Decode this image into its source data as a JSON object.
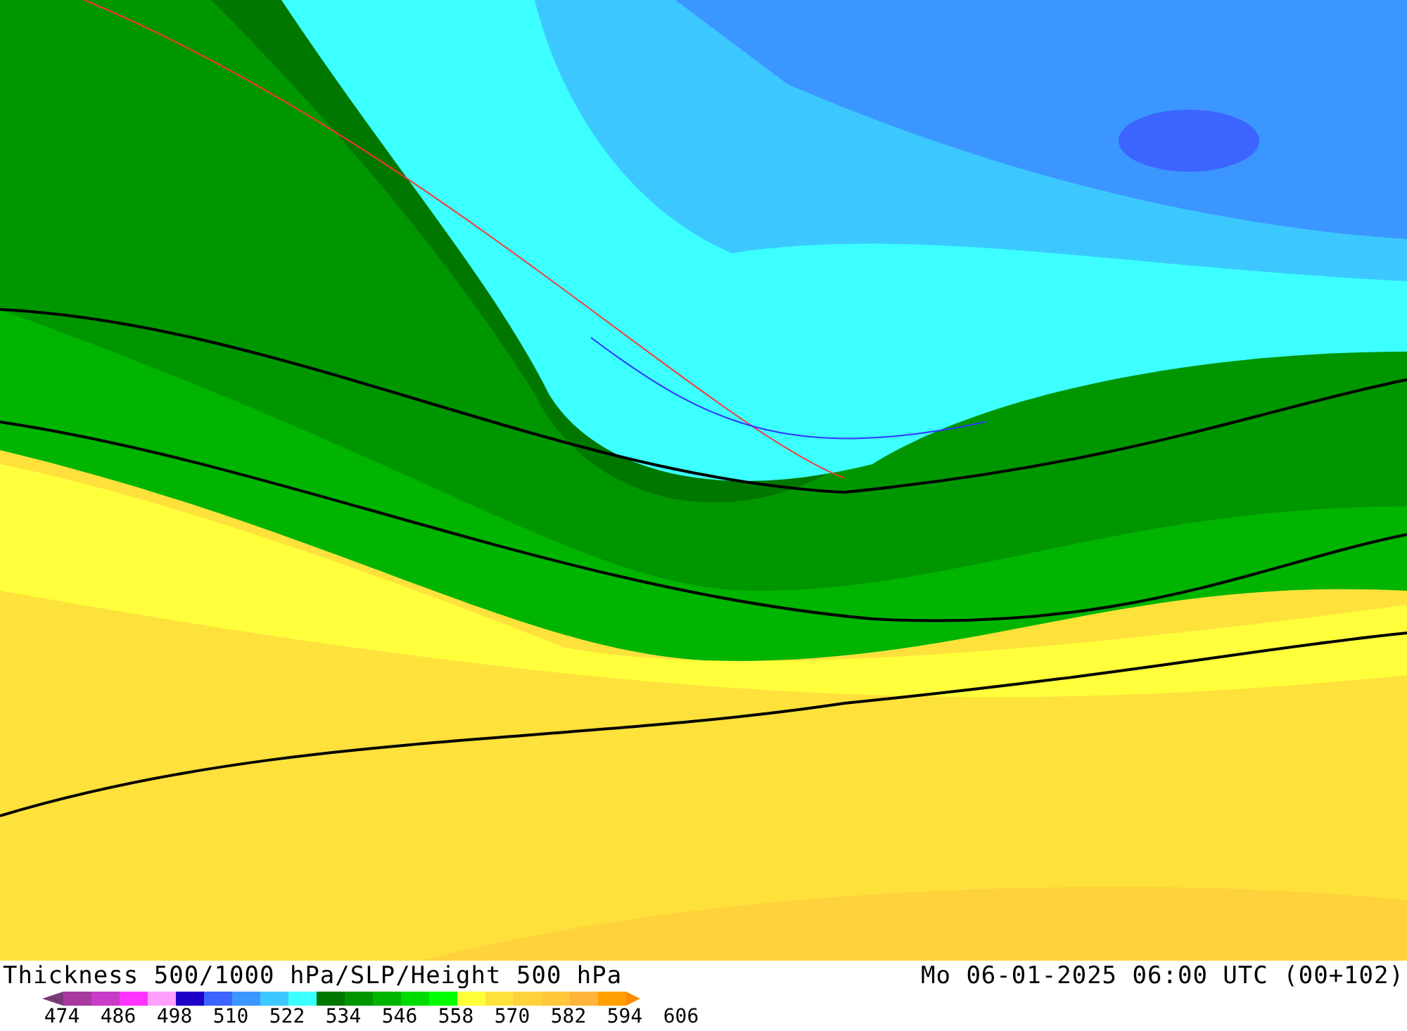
{
  "title": {
    "left": "Thickness 500/1000 hPa/SLP/Height 500 hPa",
    "right": "Mo 06-01-2025 06:00 UTC (00+102)"
  },
  "legend": {
    "colors": [
      {
        "color": "#7a3a7a"
      },
      {
        "color": "#a8399e"
      },
      {
        "color": "#c83cc8"
      },
      {
        "color": "#ff33ff"
      },
      {
        "color": "#ffa0ff"
      },
      {
        "color": "#1e00c8"
      },
      {
        "color": "#3c64ff"
      },
      {
        "color": "#3c96ff"
      },
      {
        "color": "#3cc8ff"
      },
      {
        "color": "#3cffff"
      },
      {
        "color": "#007800"
      },
      {
        "color": "#009600"
      },
      {
        "color": "#00b400"
      },
      {
        "color": "#00dc00"
      },
      {
        "color": "#00ff00"
      },
      {
        "color": "#ffff3c"
      },
      {
        "color": "#ffe13c"
      },
      {
        "color": "#ffd23c"
      },
      {
        "color": "#ffc83c"
      },
      {
        "color": "#ffb43c"
      },
      {
        "color": "#ffa000"
      },
      {
        "color": "#ff8c00"
      }
    ],
    "labels": [
      "474",
      "486",
      "498",
      "510",
      "522",
      "534",
      "546",
      "558",
      "570",
      "582",
      "594",
      "606"
    ]
  }
}
